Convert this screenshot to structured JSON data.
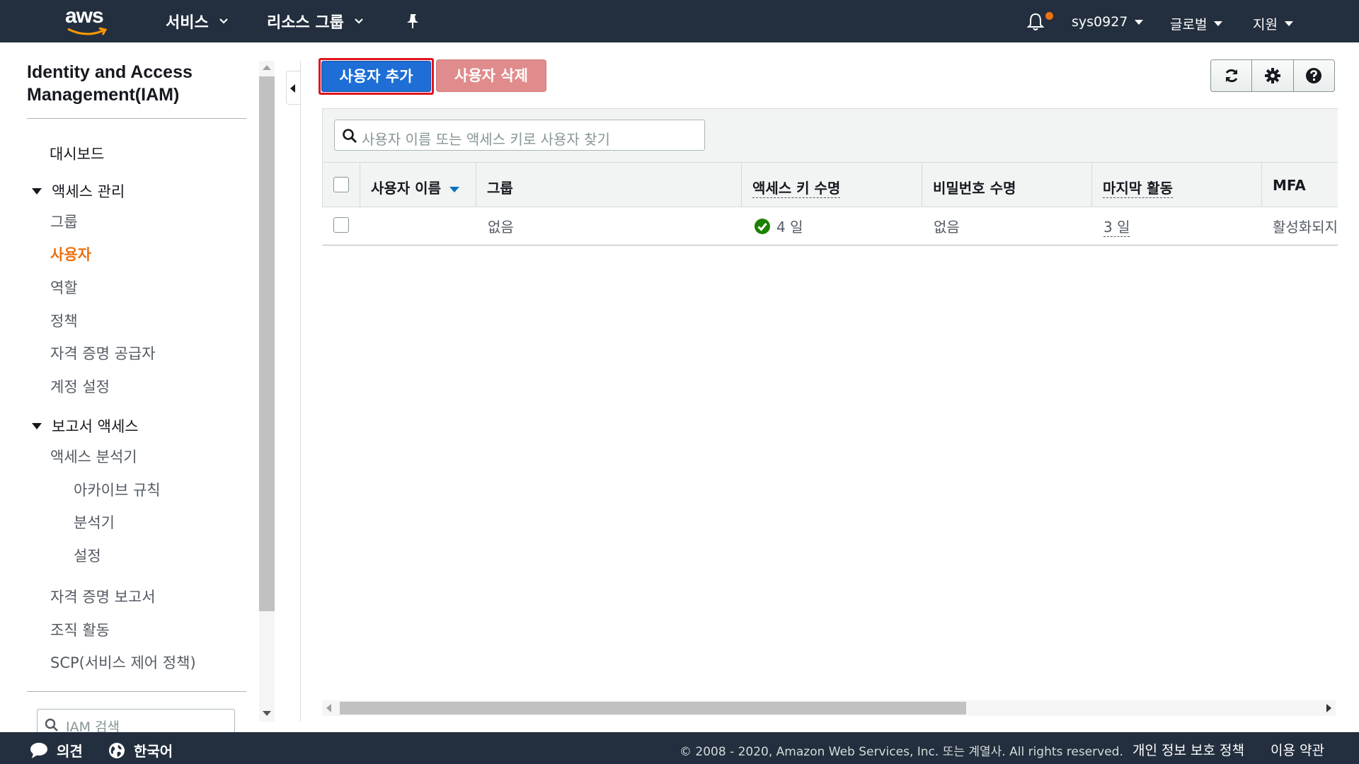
{
  "topnav": {
    "logo_text": "aws",
    "services_label": "서비스",
    "resource_groups_label": "리소스 그룹",
    "account_label": "sys0927",
    "region_label": "글로벌",
    "support_label": "지원",
    "notification_dot_color": "#ec7211"
  },
  "sidebar": {
    "title": "Identity and Access Management(IAM)",
    "dashboard": "대시보드",
    "access_management": {
      "label": "액세스 관리",
      "items": [
        "그룹",
        "사용자",
        "역할",
        "정책",
        "자격 증명 공급자",
        "계정 설정"
      ],
      "active": "사용자"
    },
    "reports": {
      "label": "보고서 액세스",
      "analyzer": "액세스 분석기",
      "sub_items": [
        "아카이브 규칙",
        "분석기",
        "설정"
      ],
      "items": [
        "자격 증명 보고서",
        "조직 활동",
        "SCP(서비스 제어 정책)"
      ]
    },
    "search_placeholder": "IAM 검색"
  },
  "toolbar": {
    "add_user_label": "사용자 추가",
    "delete_user_label": "사용자 삭제",
    "icons": [
      "refresh-icon",
      "gear-icon",
      "help-icon"
    ]
  },
  "users_table": {
    "search_placeholder": "사용자 이름 또는 액세스 키로 사용자 찾기",
    "columns": [
      "사용자 이름",
      "그룹",
      "액세스 키 수명",
      "비밀번호 수명",
      "마지막 활동",
      "MFA"
    ],
    "rows": [
      {
        "user_name": "",
        "groups": "없음",
        "access_key_age": "4 일",
        "password_age": "없음",
        "last_activity": "3 일",
        "mfa": "활성화되지"
      }
    ]
  },
  "footer": {
    "feedback": "의견",
    "language": "한국어",
    "copyright": "© 2008 - 2020, Amazon Web Services, Inc. 또는 계열사. All rights reserved.",
    "privacy_policy": "개인 정보 보호 정책",
    "terms": "이용 약관"
  },
  "colors": {
    "nav_bg": "#232f3e",
    "accent_orange": "#ec7211",
    "primary_blue": "#1e6ed6",
    "danger_disabled": "#e08b8c",
    "success_green": "#1d8102"
  }
}
